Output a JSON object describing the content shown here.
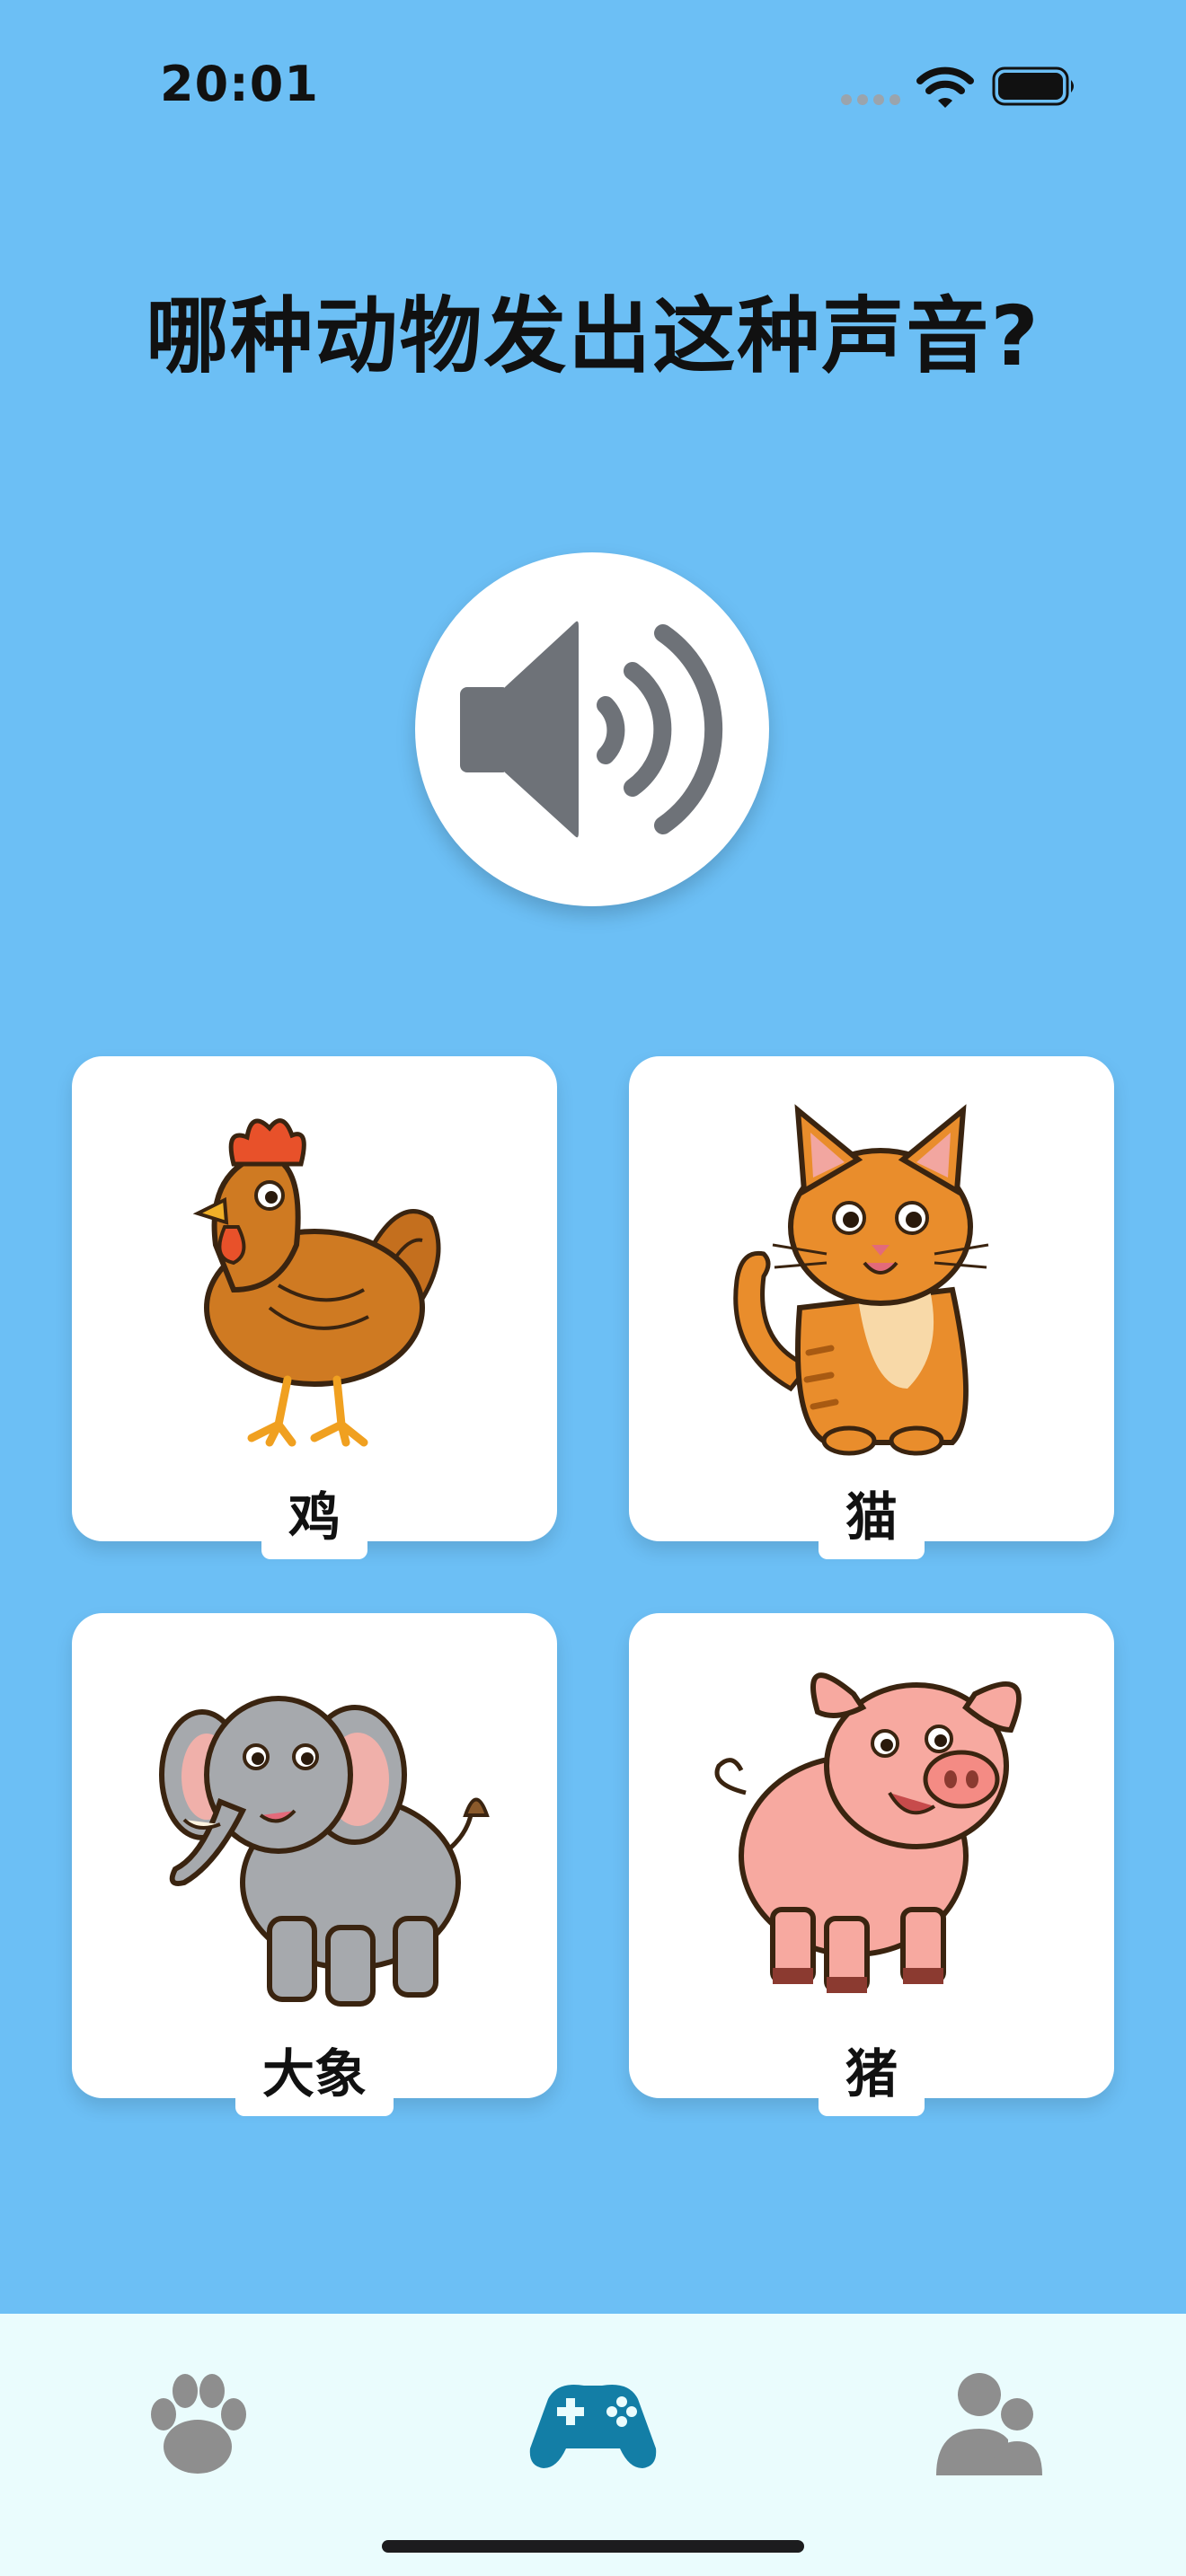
{
  "status": {
    "time": "20:01"
  },
  "question": {
    "title": "哪种动物发出这种声音?"
  },
  "play_button": {
    "icon": "speaker-icon"
  },
  "options": [
    {
      "label": "鸡",
      "icon": "chicken-illustration"
    },
    {
      "label": "猫",
      "icon": "cat-illustration"
    },
    {
      "label": "大象",
      "icon": "elephant-illustration"
    },
    {
      "label": "猪",
      "icon": "pig-illustration"
    }
  ],
  "tab_bar": {
    "tabs": [
      {
        "icon": "paw-icon",
        "active": false
      },
      {
        "icon": "gamepad-icon",
        "active": true
      },
      {
        "icon": "users-icon",
        "active": false
      }
    ]
  },
  "colors": {
    "background": "#6cbff5",
    "tab_bar": "#eafcfd",
    "active_tab": "#137ea6",
    "inactive_tab": "#8e8e8e",
    "speaker": "#6e7278"
  }
}
